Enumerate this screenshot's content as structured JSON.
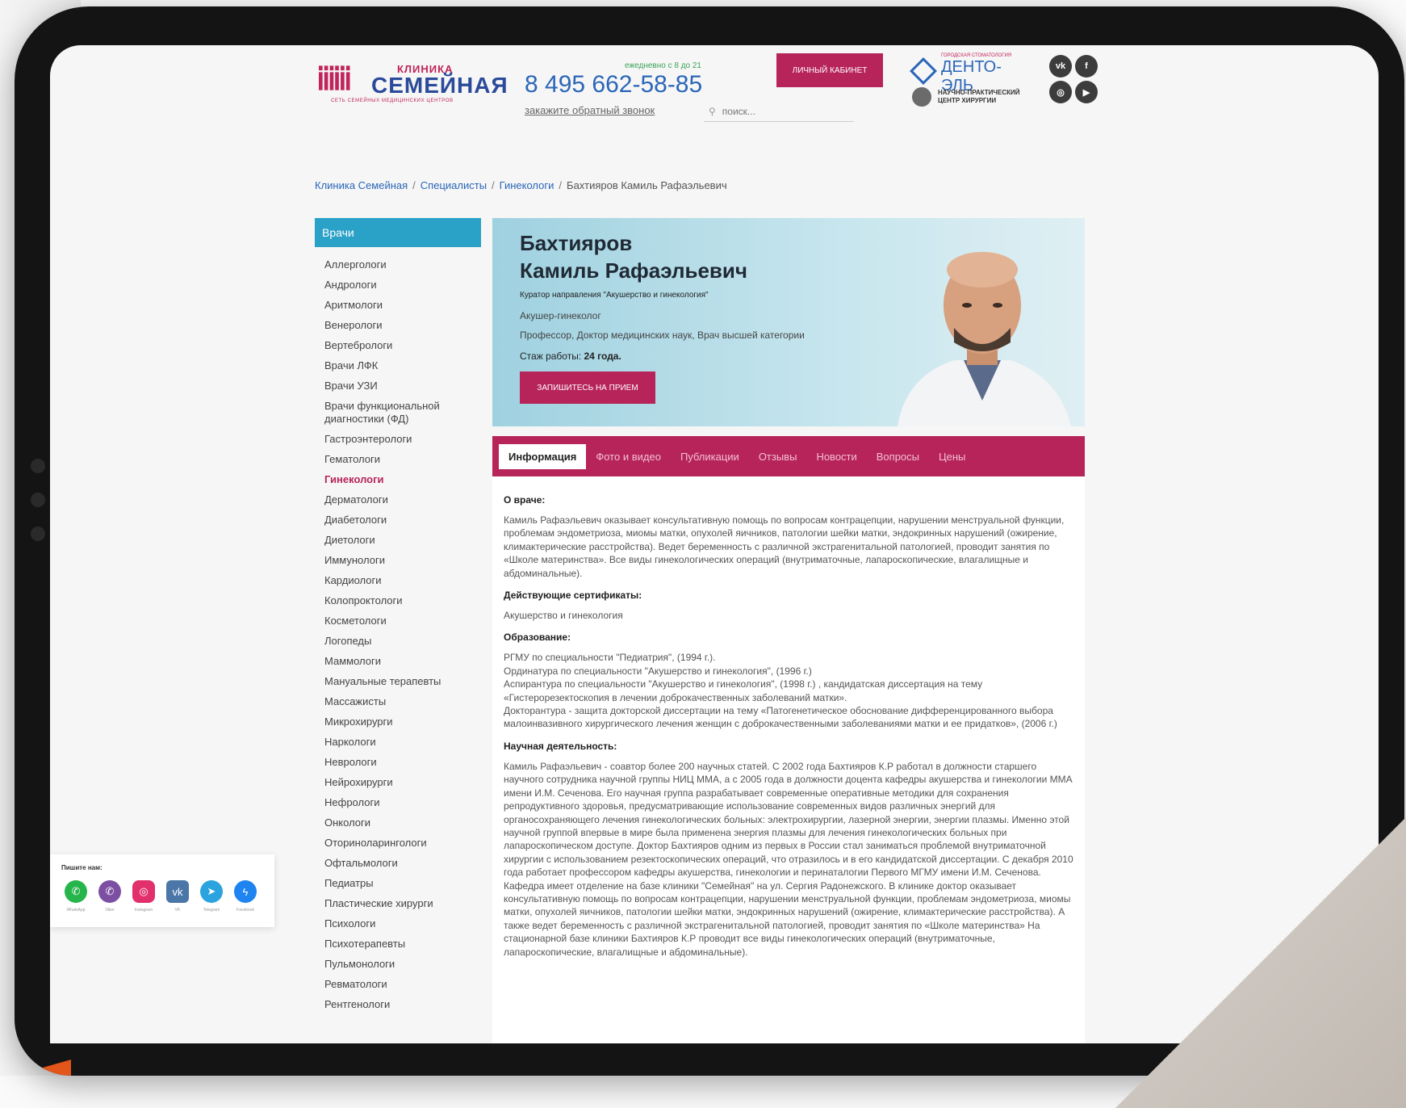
{
  "header": {
    "logo_small": "КЛИНИКА",
    "logo_name": "СЕМЕЙНАЯ",
    "logo_tagline": "СЕТЬ СЕМЕЙНЫХ МЕДИЦИНСКИХ ЦЕНТРОВ",
    "hours": "ежедневно с 8 до 21",
    "phone": "8 495 662-58-85",
    "callback": "закажите обратный звонок",
    "cabinet_button": "личный кабинет",
    "search_placeholder": "поиск...",
    "partner_small": "ГОРОДСКАЯ СТОМАТОЛОГИЯ",
    "partner_name": "ДЕНТО-ЭЛЬ",
    "center_name_1": "НАУЧНО-ПРАКТИЧЕСКИЙ",
    "center_name_2": "ЦЕНТР ХИРУРГИИ",
    "social": [
      "vk-icon",
      "facebook-icon",
      "instagram-icon",
      "youtube-icon"
    ]
  },
  "breadcrumb": {
    "items": [
      "Клиника Семейная",
      "Специалисты",
      "Гинекологи"
    ],
    "current": "Бахтияров Камиль Рафаэльевич"
  },
  "sidebar": {
    "title": "Врачи",
    "items": [
      "Аллергологи",
      "Андрологи",
      "Аритмологи",
      "Венерологи",
      "Вертебрологи",
      "Врачи ЛФК",
      "Врачи УЗИ",
      "Врачи функциональной диагностики (ФД)",
      "Гастроэнтерологи",
      "Гематологи",
      "Гинекологи",
      "Дерматологи",
      "Диабетологи",
      "Диетологи",
      "Иммунологи",
      "Кардиологи",
      "Колопроктологи",
      "Косметологи",
      "Логопеды",
      "Маммологи",
      "Мануальные терапевты",
      "Массажисты",
      "Микрохирурги",
      "Наркологи",
      "Неврологи",
      "Нейрохирурги",
      "Нефрологи",
      "Онкологи",
      "Оториноларингологи",
      "Офтальмологи",
      "Педиатры",
      "Пластические хирурги",
      "Психологи",
      "Психотерапевты",
      "Пульмонологи",
      "Ревматологи",
      "Рентгенологи"
    ],
    "active_index": 10
  },
  "doctor": {
    "last_name": "Бахтияров",
    "first_names": "Камиль Рафаэльевич",
    "curator": "Куратор направления \"Акушерство и гинекология\"",
    "specialty": "Акушер-гинеколог",
    "degree": "Профессор, Доктор медицинских наук, Врач высшей категории",
    "experience_label": "Стаж работы:",
    "experience_value": "24 года.",
    "appoint_button": "запишитесь на прием"
  },
  "tabs": [
    "Информация",
    "Фото и видео",
    "Публикации",
    "Отзывы",
    "Новости",
    "Вопросы",
    "Цены"
  ],
  "content": {
    "about_title": "О враче:",
    "about_text": "Камиль Рафаэльевич оказывает консультативную помощь по вопросам контрацепции, нарушении менструальной функции, проблемам эндометриоза, миомы матки, опухолей яичников, патологии шейки матки, эндокринных нарушений (ожирение, климактерические расстройства). Ведет беременность с различной экстрагенитальной патологией, проводит занятия по «Школе материнства». Все виды гинекологических операций (внутриматочные, лапароскопические, влагалищные и абдоминальные).",
    "cert_title": "Действующие сертификаты:",
    "cert_text": "Акушерство и гинекология",
    "edu_title": "Образование:",
    "edu_1": "РГМУ по специальности \"Педиатрия\", (1994 г.).",
    "edu_2": "Ординатура по специальности \"Акушерство и гинекология\", (1996 г.)",
    "edu_3": "Аспирантура по специальности \"Акушерство и гинекология\", (1998 г.) , кандидатская диссертация на тему «Гистерорезектоскопия в лечении доброкачественных заболеваний матки».",
    "edu_4": "Докторантура - защита докторской диссертации на тему «Патогенетическое обоснование дифференцированного выбора малоинвазивного хирургического лечения женщин с доброкачественными заболеваниями матки и ее придатков», (2006 г.)",
    "sci_title": "Научная деятельность:",
    "sci_text": "Камиль Рафаэльевич - соавтор более 200 научных статей. С 2002 года Бахтияров К.Р работал в должности старшего научного сотрудника научной группы НИЦ ММА, а с 2005 года в должности доцента кафедры акушерства и гинекологии ММА имени И.М. Сеченова. Его научная группа разрабатывает современные оперативные методики для сохранения репродуктивного здоровья, предусматривающие использование современных видов различных энергий для органосохраняющего лечения гинекологических больных: электрохирургии, лазерной энергии, энергии плазмы. Именно этой научной группой впервые в мире была применена энергия плазмы для лечения гинекологических больных при лапароскопическом доступе. Доктор Бахтияров одним из первых в России стал заниматься проблемой внутриматочной хирургии с использованием резектоскопических операций, что отразилось и в его кандидатской диссертации. С декабря 2010 года работает профессором кафедры акушерства, гинекологии и перинаталогии Первого МГМУ имени И.М. Сеченова. Кафедра имеет отделение на базе клиники \"Семейная\" на ул. Сергия Радонежского. В клинике доктор оказывает консультативную помощь по вопросам контрацепции, нарушении менструальной функции, проблемам эндометриоза, миомы матки, опухолей яичников, патологии шейки матки, эндокринных нарушений (ожирение, климактерические расстройства). А также ведет беременность с различной экстрагенитальной патологией, проводит занятия по «Школе материнства» На стационарной базе клиники Бахтияров К.Р проводит все виды гинекологических операций (внутриматочные, лапароскопические, влагалищные и абдоминальные)."
  },
  "widget": {
    "title": "Пишите нам:",
    "messengers": [
      {
        "label": "WhatsApp",
        "icon": "whatsapp-icon",
        "color": "#25b54a"
      },
      {
        "label": "Viber",
        "icon": "viber-icon",
        "color": "#7d4fa3"
      },
      {
        "label": "Instagram",
        "icon": "instagram-icon",
        "color": "#e1306c"
      },
      {
        "label": "VK",
        "icon": "vk-icon",
        "color": "#4a76a8"
      },
      {
        "label": "Telegram",
        "icon": "telegram-icon",
        "color": "#2aa3df"
      },
      {
        "label": "Facebook",
        "icon": "messenger-icon",
        "color": "#1f84f0"
      }
    ]
  },
  "colors": {
    "accent": "#b7245a",
    "sidebar_head": "#2aa1c6",
    "link": "#2a66b8"
  }
}
